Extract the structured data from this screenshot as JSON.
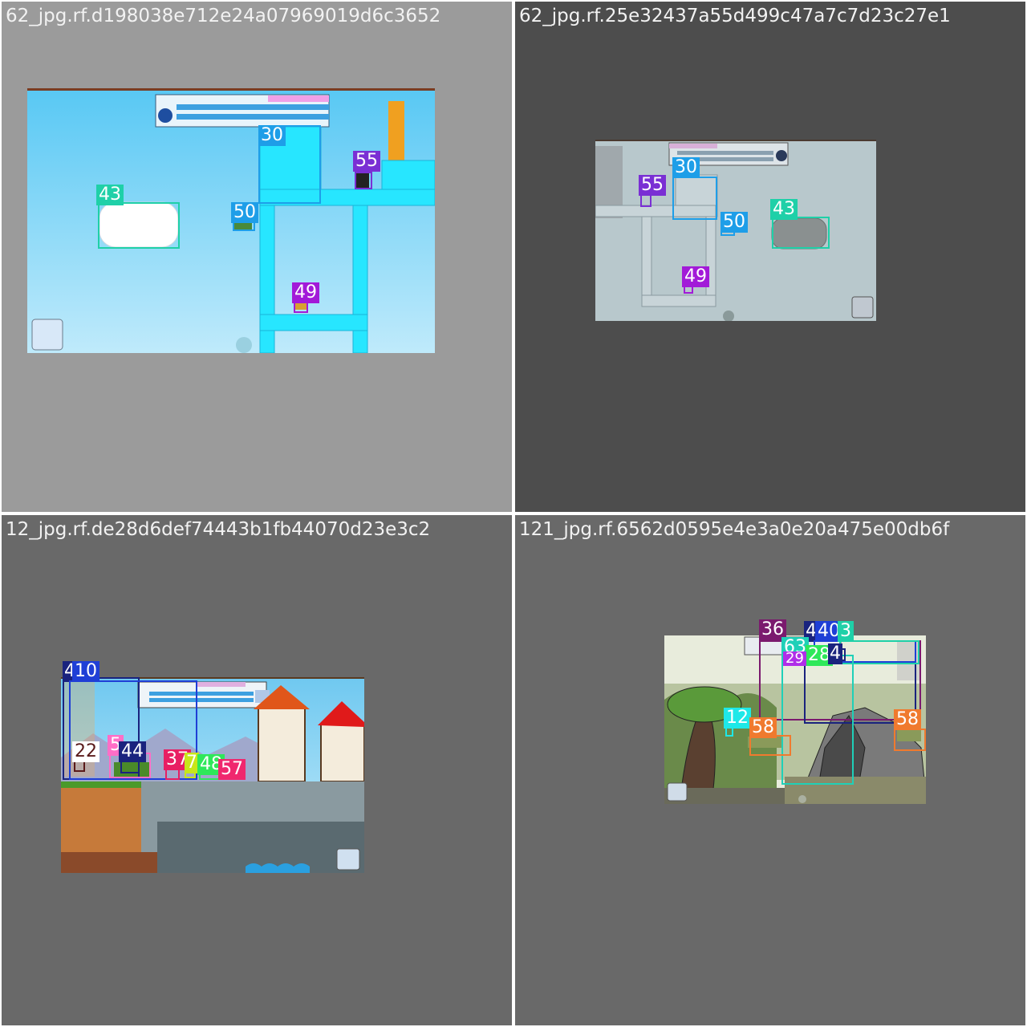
{
  "panels": [
    {
      "title": "62_jpg.rf.d198038e712e24a07969019d6c3652",
      "background": "#9b9b9b",
      "labels": [
        {
          "text": "30",
          "color": "#1e9ee8"
        },
        {
          "text": "55",
          "color": "#7a2fd4"
        },
        {
          "text": "43",
          "color": "#1fd0a8"
        },
        {
          "text": "50",
          "color": "#1e9ee8"
        },
        {
          "text": "49",
          "color": "#a21ad8"
        }
      ]
    },
    {
      "title": "62_jpg.rf.25e32437a55d499c47a7c7d23c27e1",
      "background": "#4d4d4d",
      "labels": [
        {
          "text": "30",
          "color": "#1e9ee8"
        },
        {
          "text": "55",
          "color": "#7a2fd4"
        },
        {
          "text": "50",
          "color": "#1e9ee8"
        },
        {
          "text": "43",
          "color": "#1fd0a8"
        },
        {
          "text": "49",
          "color": "#a21ad8"
        }
      ]
    },
    {
      "title": "12_jpg.rf.de28d6def74443b1fb44070d23e3c2",
      "background": "#696969",
      "labels": [
        {
          "text": "4",
          "color": "#1a237e"
        },
        {
          "text": "10",
          "color": "#1f3fd6"
        },
        {
          "text": "22",
          "color": "#ffffff"
        },
        {
          "text": "5",
          "color": "#ff6ec7"
        },
        {
          "text": "44",
          "color": "#1a237e"
        },
        {
          "text": "37",
          "color": "#e81e63"
        },
        {
          "text": "7",
          "color": "#c8e61a"
        },
        {
          "text": "48",
          "color": "#2ee85a"
        },
        {
          "text": "57",
          "color": "#f0286e"
        }
      ]
    },
    {
      "title": "121_jpg.rf.6562d0595e4e3a0e20a475e00db6f",
      "background": "#696969",
      "labels": [
        {
          "text": "36",
          "color": "#7b1a6e"
        },
        {
          "text": "4",
          "color": "#1a237e"
        },
        {
          "text": "40",
          "color": "#1f3fd6"
        },
        {
          "text": "3",
          "color": "#1fd0a8"
        },
        {
          "text": "63",
          "color": "#1fd0b8"
        },
        {
          "text": "28",
          "color": "#2ee85a"
        },
        {
          "text": "29",
          "color": "#b02ee8"
        },
        {
          "text": "4",
          "color": "#1a237e"
        },
        {
          "text": "12",
          "color": "#1ee8e8"
        },
        {
          "text": "58",
          "color": "#f07a2e"
        },
        {
          "text": "58",
          "color": "#f07a2e"
        }
      ]
    }
  ]
}
